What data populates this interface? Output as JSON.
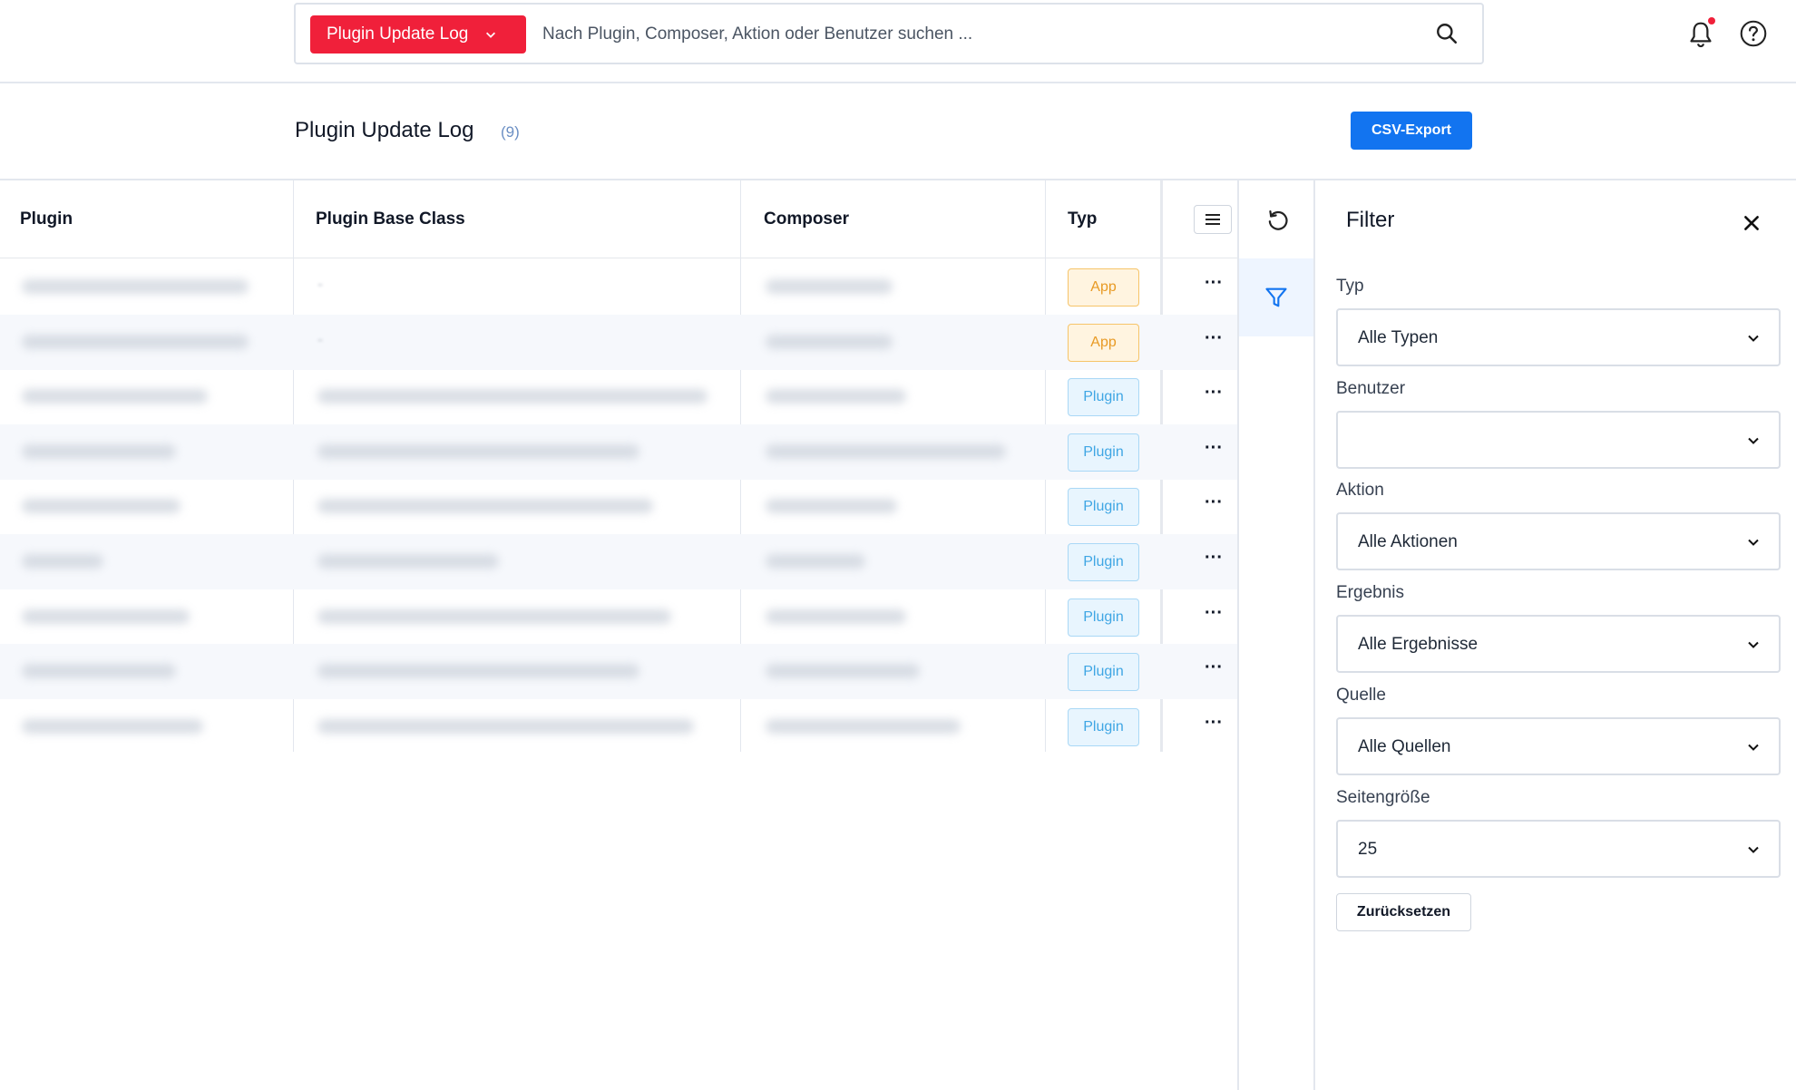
{
  "topbar": {
    "module_label": "Plugin Update Log",
    "search_placeholder": "Nach Plugin, Composer, Aktion oder Benutzer suchen ..."
  },
  "header": {
    "title": "Plugin Update Log",
    "count": "(9)",
    "csv_export_label": "CSV-Export"
  },
  "table": {
    "columns": [
      "Plugin",
      "Plugin Base Class",
      "Composer",
      "Typ"
    ],
    "rows": [
      {
        "type": "App",
        "row_menu": "···"
      },
      {
        "type": "App",
        "row_menu": "···"
      },
      {
        "type": "Plugin",
        "row_menu": "···"
      },
      {
        "type": "Plugin",
        "row_menu": "···"
      },
      {
        "type": "Plugin",
        "row_menu": "···"
      },
      {
        "type": "Plugin",
        "row_menu": "···"
      },
      {
        "type": "Plugin",
        "row_menu": "···"
      },
      {
        "type": "Plugin",
        "row_menu": "···"
      },
      {
        "type": "Plugin",
        "row_menu": "···"
      }
    ]
  },
  "filter": {
    "title": "Filter",
    "fields": [
      {
        "label": "Typ",
        "value": "Alle Typen"
      },
      {
        "label": "Benutzer",
        "value": ""
      },
      {
        "label": "Aktion",
        "value": "Alle Aktionen"
      },
      {
        "label": "Ergebnis",
        "value": "Alle Ergebnisse"
      },
      {
        "label": "Quelle",
        "value": "Alle Quellen"
      },
      {
        "label": "Seitengröße",
        "value": "25"
      }
    ],
    "reset_label": "Zurücksetzen"
  },
  "colors": {
    "brand_red": "#f0203a",
    "primary_blue": "#1274f0",
    "app_badge": "#e89a24",
    "plugin_badge": "#3fa6e4"
  },
  "icons": [
    "chevron-down-icon",
    "search-icon",
    "bell-icon",
    "help-icon",
    "list-icon",
    "reset-icon",
    "filter-icon",
    "close-icon",
    "more-icon"
  ]
}
